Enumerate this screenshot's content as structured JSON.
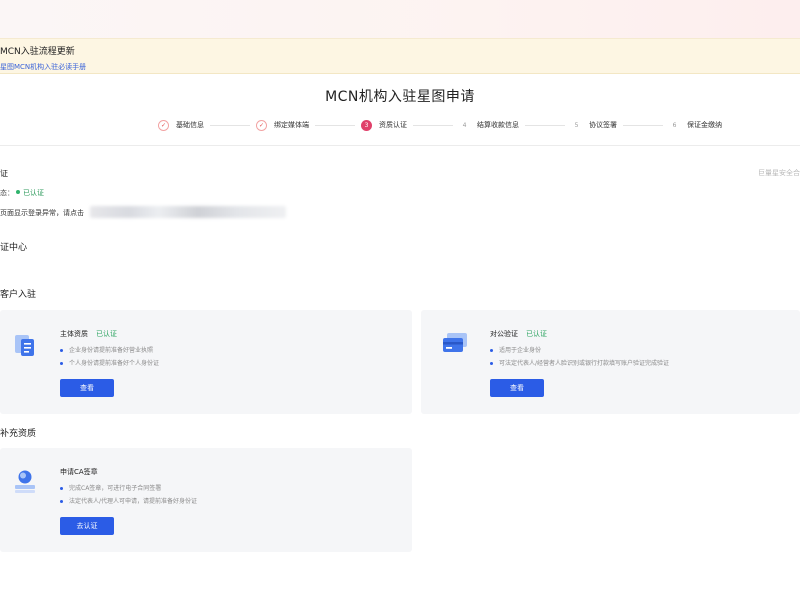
{
  "notice": {
    "title": "MCN入驻流程更新",
    "link": "星图MCN机构入驻必读手册"
  },
  "page_title": "MCN机构入驻星图申请",
  "steps": [
    {
      "index": "✓",
      "label": "基础信息",
      "state": "done"
    },
    {
      "index": "✓",
      "label": "绑定媒体端",
      "state": "done"
    },
    {
      "index": "3",
      "label": "资质认证",
      "state": "active"
    },
    {
      "index": "4",
      "label": "结算收款信息",
      "state": "todo"
    },
    {
      "index": "5",
      "label": "协议签署",
      "state": "todo"
    },
    {
      "index": "6",
      "label": "保证金缴纳",
      "state": "todo"
    }
  ],
  "status": {
    "title": "证",
    "right_text": "巨量星安全合",
    "state_prefix": "态：",
    "state_value": "已认证",
    "tip": "页面显示登录异常，请点击"
  },
  "sections": {
    "cert_center": "证中心",
    "customer_entry": "客户入驻",
    "supplementary": "补充资质"
  },
  "cards": {
    "entity": {
      "title": "主体资质",
      "badge": "已认证",
      "bullets": [
        "企业身份请提前准备好营业执照",
        "个人身份请提前准备好个人身份证"
      ],
      "button": "查看"
    },
    "corporate": {
      "title": "对公验证",
      "badge": "已认证",
      "bullets": [
        "适用于企业身份",
        "可法定代表人/经营者人脸识别或银行打款填写账户验证完成验证"
      ],
      "button": "查看"
    },
    "ca": {
      "title": "申请CA签章",
      "badge": "",
      "bullets": [
        "完成CA签章，可进行电子合同签署",
        "法定代表人/代理人可申请，请提前准备好身份证"
      ],
      "button": "去认证"
    }
  },
  "colors": {
    "primary": "#2b5ce6",
    "active_step": "#e0406a",
    "success": "#2fa563",
    "notice_bg": "#fdf6e3"
  }
}
